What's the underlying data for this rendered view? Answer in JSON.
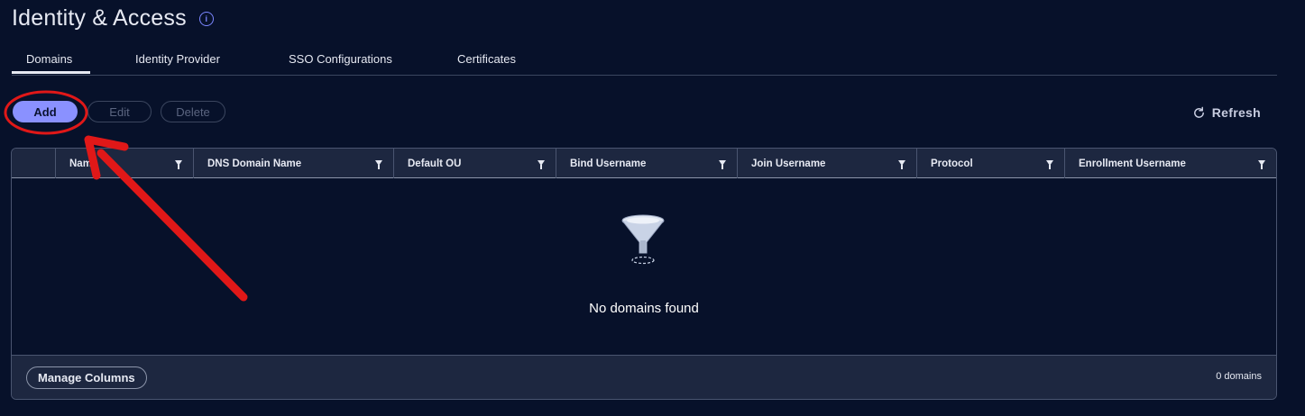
{
  "page": {
    "title": "Identity & Access",
    "info_icon": "i"
  },
  "tabs": [
    {
      "label": "Domains",
      "active": true
    },
    {
      "label": "Identity Provider",
      "active": false
    },
    {
      "label": "SSO Configurations",
      "active": false
    },
    {
      "label": "Certificates",
      "active": false
    }
  ],
  "toolbar": {
    "add": "Add",
    "edit": "Edit",
    "delete": "Delete",
    "refresh": "Refresh"
  },
  "grid": {
    "columns": [
      "Name",
      "DNS Domain Name",
      "Default OU",
      "Bind Username",
      "Join Username",
      "Protocol",
      "Enrollment Username"
    ],
    "empty_message": "No domains found",
    "footer": {
      "manage_columns": "Manage Columns",
      "count": "0 domains"
    }
  },
  "colors": {
    "accent": "#8a91ff",
    "background": "#07112a",
    "annotation": "#e01818"
  },
  "icons": {
    "info": "info-icon",
    "refresh": "refresh-icon",
    "filter": "filter-icon",
    "empty": "funnel-empty-icon"
  }
}
